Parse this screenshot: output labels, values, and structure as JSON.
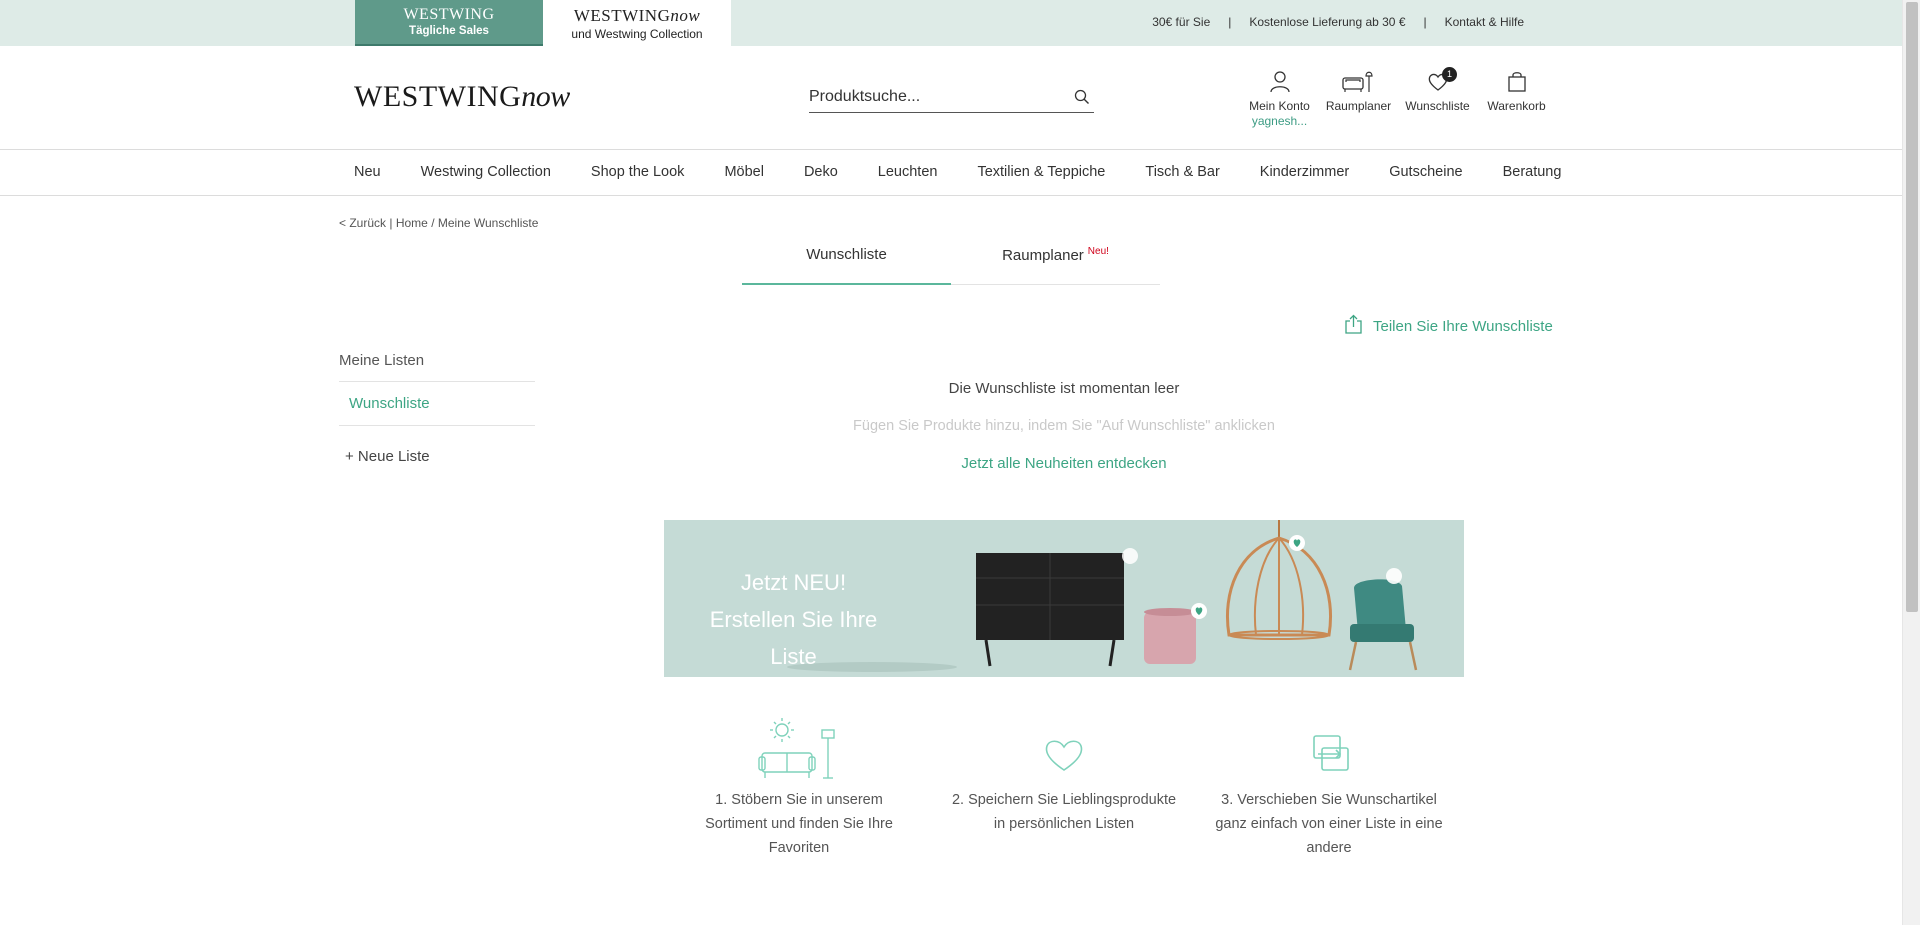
{
  "topbar": {
    "brand_sales": {
      "logo": "WESTWING",
      "sub": "Tägliche Sales"
    },
    "brand_now": {
      "logo": "WESTWING",
      "logo_italic": "now",
      "sub": "und Westwing Collection"
    },
    "links": [
      "30€ für Sie",
      "Kostenlose Lieferung ab 30 €",
      "Kontakt & Hilfe"
    ],
    "separator": "|"
  },
  "header": {
    "logo": "WESTWING",
    "logo_italic": "now",
    "search_placeholder": "Produktsuche...",
    "icons": {
      "account": {
        "label": "Mein Konto",
        "user": "yagnesh..."
      },
      "planner": {
        "label": "Raumplaner"
      },
      "wishlist": {
        "label": "Wunschliste",
        "count": "1"
      },
      "cart": {
        "label": "Warenkorb"
      }
    }
  },
  "nav": {
    "items": [
      "Neu",
      "Westwing Collection",
      "Shop the Look",
      "Möbel",
      "Deko",
      "Leuchten",
      "Textilien & Teppiche",
      "Tisch & Bar",
      "Kinderzimmer",
      "Gutscheine",
      "Beratung"
    ]
  },
  "breadcrumb": {
    "back": "< Zurück",
    "divider": "|",
    "home": "Home",
    "slash": "/",
    "current": "Meine Wunschliste"
  },
  "tabs": {
    "wishlist": "Wunschliste",
    "planner": "Raumplaner",
    "planner_badge": "Neu!"
  },
  "share": {
    "label": "Teilen Sie Ihre Wunschliste"
  },
  "sidebar": {
    "heading": "Meine Listen",
    "items": [
      "Wunschliste"
    ],
    "new_list": "+ Neue Liste"
  },
  "empty": {
    "title": "Die Wunschliste ist momentan leer",
    "hint": "Fügen Sie Produkte hinzu, indem Sie \"Auf Wunschliste\" anklicken",
    "cta": "Jetzt alle Neuheiten entdecken"
  },
  "banner": {
    "line1": "Jetzt NEU!",
    "line2": "Erstellen Sie Ihre Liste"
  },
  "steps": [
    {
      "text": "1. Stöbern Sie in unserem Sortiment und finden Sie Ihre Favoriten"
    },
    {
      "text": "2. Speichern Sie Lieblingsprodukte in persönlichen Listen"
    },
    {
      "text": "3. Verschieben Sie Wunschartikel ganz einfach von einer Liste in eine andere"
    }
  ],
  "colors": {
    "accent": "#3da584",
    "topbar_bg": "#deebe7",
    "sales_tab": "#5f9a8a",
    "banner_bg": "#c5dbd6",
    "new_badge": "#d0021b"
  }
}
